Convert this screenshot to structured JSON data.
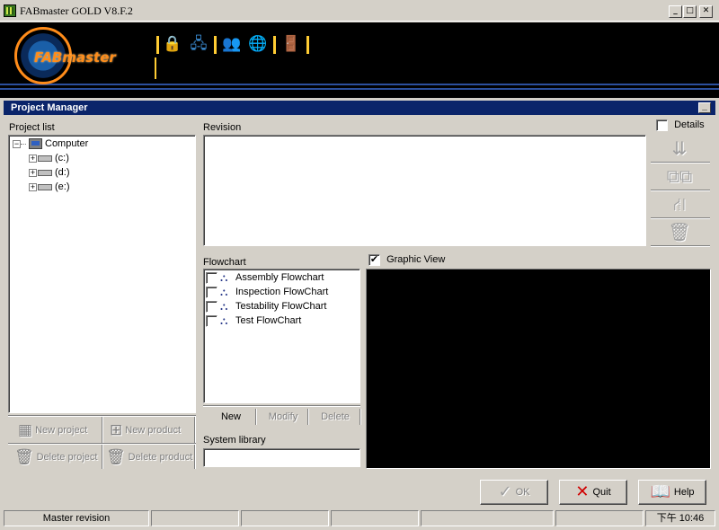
{
  "window": {
    "title": "FABmaster GOLD V8.F.2",
    "min_label": "_",
    "max_label": "□",
    "close_label": "✕"
  },
  "banner": {
    "logo_text": "FABmaster",
    "toolbar_icons": [
      "lock-icon",
      "network-user-icon",
      "users-icon",
      "globe-icon",
      "exit-door-icon"
    ]
  },
  "panel": {
    "title": "Project Manager",
    "min_label": "_"
  },
  "project_list": {
    "label": "Project list",
    "root": "Computer",
    "drives": [
      "(c:)",
      "(d:)",
      "(e:)"
    ]
  },
  "project_buttons": {
    "new_project": "New project",
    "new_product": "New product",
    "delete_project": "Delete project",
    "delete_product": "Delete product"
  },
  "revision": {
    "label": "Revision",
    "details_label": "Details",
    "details_checked": false
  },
  "flowchart": {
    "label": "Flowchart",
    "items": [
      {
        "label": "Assembly Flowchart",
        "checked": false
      },
      {
        "label": "Inspection FlowChart",
        "checked": false
      },
      {
        "label": "Testability FlowChart",
        "checked": false
      },
      {
        "label": "Test FlowChart",
        "checked": false
      }
    ],
    "new_label": "New",
    "modify_label": "Modify",
    "delete_label": "Delete"
  },
  "graphic_view": {
    "label": "Graphic View",
    "checked": true,
    "background": "#000000"
  },
  "system_library": {
    "label": "System library",
    "value": ""
  },
  "actions": {
    "ok": "OK",
    "quit": "Quit",
    "help": "Help"
  },
  "status_bar": {
    "mode": "Master revision",
    "clock": "下午 10:46"
  },
  "colors": {
    "panel_header": "#0a246a",
    "face": "#d4d0c8",
    "accent_orange": "#ff8c1a",
    "banner_line": "#2b4e9c"
  }
}
